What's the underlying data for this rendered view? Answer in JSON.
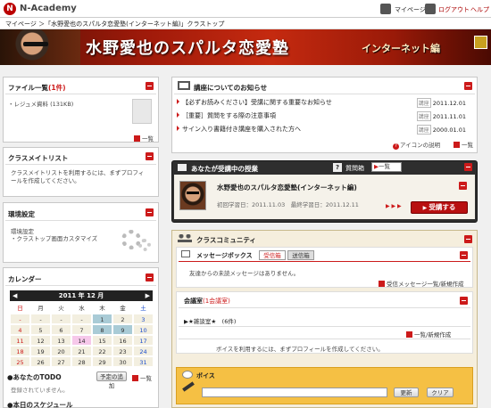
{
  "header": {
    "logo_mark": "N",
    "logo_text": "N-Academy",
    "links": {
      "mypage": "マイページ",
      "logout": "ログアウト",
      "help": "ヘルプ"
    }
  },
  "breadcrumb": "マイページ ＞「水野愛也のスパルタ恋愛塾(インターネット編)」クラストップ",
  "banner": {
    "title": "水野愛也のスパルタ恋愛塾",
    "subtitle": "インターネット編"
  },
  "files_panel": {
    "title": "ファイル一覧",
    "count": "(1件)",
    "file": "レジュメ資料 (131KB)",
    "more": "一覧"
  },
  "classmate_panel": {
    "title": "クラスメイトリスト",
    "text": "クラスメイトリストを利用するには、まずプロフィールを作成してください。"
  },
  "env_panel": {
    "title": "環境設定",
    "line1": "環境設定",
    "line2": "・クラストップ画面カスタマイズ"
  },
  "calendar_panel": {
    "title": "カレンダー",
    "month": "2011 年 12 月",
    "weekdays": [
      "日",
      "月",
      "火",
      "水",
      "木",
      "金",
      "土"
    ],
    "weeks": [
      [
        "-",
        "-",
        "-",
        "-",
        "1",
        "2",
        "3"
      ],
      [
        "4",
        "5",
        "6",
        "7",
        "8",
        "9",
        "10"
      ],
      [
        "11",
        "12",
        "13",
        "14",
        "15",
        "16",
        "17"
      ],
      [
        "18",
        "19",
        "20",
        "21",
        "22",
        "23",
        "24"
      ],
      [
        "25",
        "26",
        "27",
        "28",
        "29",
        "30",
        "31"
      ]
    ],
    "todo_title": "●あなたのTODO",
    "todo_add": "予定の追加",
    "todo_more": "一覧",
    "todo_empty": "登録されていません。",
    "schedule_title": "●本日のスケジュール"
  },
  "news_panel": {
    "title": "講座についてのお知らせ",
    "tag": "講座",
    "items": [
      {
        "text": "【必ずお読みください】受講に関する重要なお知らせ",
        "date": "2011.12.01"
      },
      {
        "text": "［重要］質問をする際の注意事項",
        "date": "2011.11.01"
      },
      {
        "text": "サイン入り書籍付き講座を購入された方へ",
        "date": "2000.01.01"
      }
    ],
    "icon_note": "アイコンの説明",
    "more": "一覧"
  },
  "course_panel": {
    "title": "あなたが受講中の授業",
    "qa_label": "質問箱",
    "qa_more": "一覧",
    "course_name": "水野愛也のスパルタ恋愛塾(インターネット編)",
    "dates": "初回学習日：2011.11.03　最終学習日：2011.12.11",
    "button": "受講する",
    "arrows": "▶ ▶ ▶"
  },
  "community_panel": {
    "title": "クラスコミュニティ",
    "msg_title": "メッセージボックス",
    "tab_inbox": "受信箱",
    "tab_sent": "送信箱",
    "msg_empty": "友達からの未読メッセージはありません。",
    "msg_link": "受信メッセージ一覧/新規作成",
    "room_title": "会議室",
    "room_count": "(1会議室)",
    "room_item": "★雑談室★",
    "room_item_count": "(6件)",
    "room_link": "一覧/新規作成",
    "room_note": "ボイスを利用するには、まずプロフィールを作成してください。",
    "voice_title": "ボイス",
    "update_btn": "更新",
    "clear_btn": "クリア"
  },
  "colors": {
    "accent_red": "#cc1a1a",
    "dark_panel": "#2e2e2e",
    "community_bg": "#f5eedd"
  }
}
